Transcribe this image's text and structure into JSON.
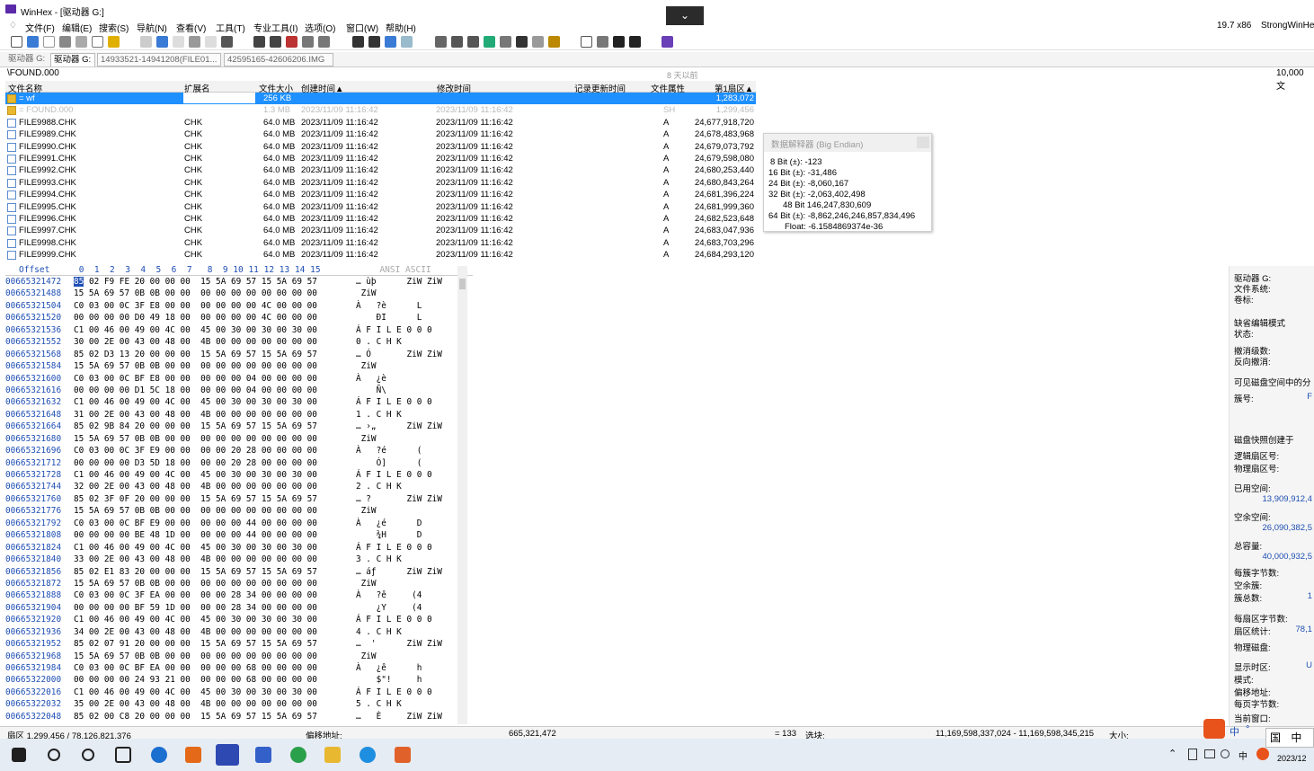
{
  "window": {
    "title": "WinHex - [驱动器 G:]",
    "version": "19.7 x86",
    "user": "StrongWinHe"
  },
  "menu": [
    "文件(F)",
    "编辑(E)",
    "搜索(S)",
    "导航(N)",
    "查看(V)",
    "工具(T)",
    "专业工具(I)",
    "选项(O)",
    "窗口(W)",
    "帮助(H)"
  ],
  "tabs": [
    "驱动器 G:",
    "驱动器 G:",
    "14933521-14941208(FILE01...",
    "42595165-42606206.IMG"
  ],
  "path": "\\FOUND.000",
  "path_middle": "8 天以前",
  "path_count": "10,000 文",
  "dir_headers": [
    "文件名称",
    "扩展名",
    "文件大小",
    "创建时间▲",
    "修改时间",
    "记录更新时间",
    "文件属性",
    "第1扇区▲"
  ],
  "dir_rows": [
    {
      "name": "= wf",
      "ext": "",
      "size": "256 KB",
      "created": "",
      "modified": "",
      "attr": "",
      "sector": "1,283,072",
      "style": "sel"
    },
    {
      "name": "= FOUND.000",
      "ext": "",
      "size": "1.3 MB",
      "created": "2023/11/09  11:16:42",
      "modified": "2023/11/09  11:16:42",
      "attr": "SH",
      "sector": "1,299,456",
      "style": "dim"
    },
    {
      "name": "FILE9988.CHK",
      "ext": "CHK",
      "size": "64.0 MB",
      "created": "2023/11/09  11:16:42",
      "modified": "2023/11/09  11:16:42",
      "attr": "A",
      "sector": "24,677,918,720",
      "style": ""
    },
    {
      "name": "FILE9989.CHK",
      "ext": "CHK",
      "size": "64.0 MB",
      "created": "2023/11/09  11:16:42",
      "modified": "2023/11/09  11:16:42",
      "attr": "A",
      "sector": "24,678,483,968",
      "style": ""
    },
    {
      "name": "FILE9990.CHK",
      "ext": "CHK",
      "size": "64.0 MB",
      "created": "2023/11/09  11:16:42",
      "modified": "2023/11/09  11:16:42",
      "attr": "A",
      "sector": "24,679,073,792",
      "style": ""
    },
    {
      "name": "FILE9991.CHK",
      "ext": "CHK",
      "size": "64.0 MB",
      "created": "2023/11/09  11:16:42",
      "modified": "2023/11/09  11:16:42",
      "attr": "A",
      "sector": "24,679,598,080",
      "style": ""
    },
    {
      "name": "FILE9992.CHK",
      "ext": "CHK",
      "size": "64.0 MB",
      "created": "2023/11/09  11:16:42",
      "modified": "2023/11/09  11:16:42",
      "attr": "A",
      "sector": "24,680,253,440",
      "style": ""
    },
    {
      "name": "FILE9993.CHK",
      "ext": "CHK",
      "size": "64.0 MB",
      "created": "2023/11/09  11:16:42",
      "modified": "2023/11/09  11:16:42",
      "attr": "A",
      "sector": "24,680,843,264",
      "style": ""
    },
    {
      "name": "FILE9994.CHK",
      "ext": "CHK",
      "size": "64.0 MB",
      "created": "2023/11/09  11:16:42",
      "modified": "2023/11/09  11:16:42",
      "attr": "A",
      "sector": "24,681,396,224",
      "style": ""
    },
    {
      "name": "FILE9995.CHK",
      "ext": "CHK",
      "size": "64.0 MB",
      "created": "2023/11/09  11:16:42",
      "modified": "2023/11/09  11:16:42",
      "attr": "A",
      "sector": "24,681,999,360",
      "style": ""
    },
    {
      "name": "FILE9996.CHK",
      "ext": "CHK",
      "size": "64.0 MB",
      "created": "2023/11/09  11:16:42",
      "modified": "2023/11/09  11:16:42",
      "attr": "A",
      "sector": "24,682,523,648",
      "style": ""
    },
    {
      "name": "FILE9997.CHK",
      "ext": "CHK",
      "size": "64.0 MB",
      "created": "2023/11/09  11:16:42",
      "modified": "2023/11/09  11:16:42",
      "attr": "A",
      "sector": "24,683,047,936",
      "style": ""
    },
    {
      "name": "FILE9998.CHK",
      "ext": "CHK",
      "size": "64.0 MB",
      "created": "2023/11/09  11:16:42",
      "modified": "2023/11/09  11:16:42",
      "attr": "A",
      "sector": "24,683,703,296",
      "style": ""
    },
    {
      "name": "FILE9999.CHK",
      "ext": "CHK",
      "size": "64.0 MB",
      "created": "2023/11/09  11:16:42",
      "modified": "2023/11/09  11:16:42",
      "attr": "A",
      "sector": "24,684,293,120",
      "style": ""
    }
  ],
  "interpreter": {
    "title": "数据解释器 (Big Endian)",
    "lines": [
      "8 Bit (±): -123",
      "16 Bit (±): -31,486",
      "24 Bit (±): -8,060,167",
      "32 Bit (±): -2,063,402,498",
      "48 Bit 146,247,830,609",
      "64 Bit (±): -8,862,246,246,857,834,496",
      "Float: -6.1584869374e-36"
    ]
  },
  "hex_header": {
    "offset": "Offset",
    "cols": " 0  1  2  3  4  5  6  7   8  9 10 11 12 13 14 15",
    "ascii": "  ANSI ASCII"
  },
  "hex_rows": [
    {
      "off": "00665321472",
      "hex": "85 02 F9 FE 20 00 00 00  15 5A 69 57 15 5A 69 57",
      "asc": "… ùþ      ZiW ZiW"
    },
    {
      "off": "00665321488",
      "hex": "15 5A 69 57 0B 0B 00 00  00 00 00 00 00 00 00 00",
      "asc": " ZiW"
    },
    {
      "off": "00665321504",
      "hex": "C0 03 00 0C 3F E8 00 00  00 00 00 00 4C 00 00 00",
      "asc": "À   ?è      L"
    },
    {
      "off": "00665321520",
      "hex": "00 00 00 00 D0 49 18 00  00 00 00 00 4C 00 00 00",
      "asc": "    ÐI      L"
    },
    {
      "off": "00665321536",
      "hex": "C1 00 46 00 49 00 4C 00  45 00 30 00 30 00 30 00",
      "asc": "Á F I L E 0 0 0"
    },
    {
      "off": "00665321552",
      "hex": "30 00 2E 00 43 00 48 00  4B 00 00 00 00 00 00 00",
      "asc": "0 . C H K"
    },
    {
      "off": "00665321568",
      "hex": "85 02 D3 13 20 00 00 00  15 5A 69 57 15 5A 69 57",
      "asc": "… Ó       ZiW ZiW"
    },
    {
      "off": "00665321584",
      "hex": "15 5A 69 57 0B 0B 00 00  00 00 00 00 00 00 00 00",
      "asc": " ZiW"
    },
    {
      "off": "00665321600",
      "hex": "C0 03 00 0C BF E8 00 00  00 00 00 04 00 00 00 00",
      "asc": "À   ¿è"
    },
    {
      "off": "00665321616",
      "hex": "00 00 00 00 D1 5C 18 00  00 00 00 04 00 00 00 00",
      "asc": "    Ñ\\"
    },
    {
      "off": "00665321632",
      "hex": "C1 00 46 00 49 00 4C 00  45 00 30 00 30 00 30 00",
      "asc": "Á F I L E 0 0 0"
    },
    {
      "off": "00665321648",
      "hex": "31 00 2E 00 43 00 48 00  4B 00 00 00 00 00 00 00",
      "asc": "1 . C H K"
    },
    {
      "off": "00665321664",
      "hex": "85 02 9B 84 20 00 00 00  15 5A 69 57 15 5A 69 57",
      "asc": "… ›„      ZiW ZiW"
    },
    {
      "off": "00665321680",
      "hex": "15 5A 69 57 0B 0B 00 00  00 00 00 00 00 00 00 00",
      "asc": " ZiW"
    },
    {
      "off": "00665321696",
      "hex": "C0 03 00 0C 3F E9 00 00  00 00 20 28 00 00 00 00",
      "asc": "À   ?é      ("
    },
    {
      "off": "00665321712",
      "hex": "00 00 00 00 D3 5D 18 00  00 00 20 28 00 00 00 00",
      "asc": "    Ó]      ("
    },
    {
      "off": "00665321728",
      "hex": "C1 00 46 00 49 00 4C 00  45 00 30 00 30 00 30 00",
      "asc": "Á F I L E 0 0 0"
    },
    {
      "off": "00665321744",
      "hex": "32 00 2E 00 43 00 48 00  4B 00 00 00 00 00 00 00",
      "asc": "2 . C H K"
    },
    {
      "off": "00665321760",
      "hex": "85 02 3F 0F 20 00 00 00  15 5A 69 57 15 5A 69 57",
      "asc": "… ?       ZiW ZiW"
    },
    {
      "off": "00665321776",
      "hex": "15 5A 69 57 0B 0B 00 00  00 00 00 00 00 00 00 00",
      "asc": " ZiW"
    },
    {
      "off": "00665321792",
      "hex": "C0 03 00 0C BF E9 00 00  00 00 00 44 00 00 00 00",
      "asc": "À   ¿é      D"
    },
    {
      "off": "00665321808",
      "hex": "00 00 00 00 BE 48 1D 00  00 00 00 44 00 00 00 00",
      "asc": "    ¾H      D"
    },
    {
      "off": "00665321824",
      "hex": "C1 00 46 00 49 00 4C 00  45 00 30 00 30 00 30 00",
      "asc": "Á F I L E 0 0 0"
    },
    {
      "off": "00665321840",
      "hex": "33 00 2E 00 43 00 48 00  4B 00 00 00 00 00 00 00",
      "asc": "3 . C H K"
    },
    {
      "off": "00665321856",
      "hex": "85 02 E1 83 20 00 00 00  15 5A 69 57 15 5A 69 57",
      "asc": "… áƒ      ZiW ZiW"
    },
    {
      "off": "00665321872",
      "hex": "15 5A 69 57 0B 0B 00 00  00 00 00 00 00 00 00 00",
      "asc": " ZiW"
    },
    {
      "off": "00665321888",
      "hex": "C0 03 00 0C 3F EA 00 00  00 00 28 34 00 00 00 00",
      "asc": "À   ?ê     (4"
    },
    {
      "off": "00665321904",
      "hex": "00 00 00 00 BF 59 1D 00  00 00 28 34 00 00 00 00",
      "asc": "    ¿Y     (4"
    },
    {
      "off": "00665321920",
      "hex": "C1 00 46 00 49 00 4C 00  45 00 30 00 30 00 30 00",
      "asc": "Á F I L E 0 0 0"
    },
    {
      "off": "00665321936",
      "hex": "34 00 2E 00 43 00 48 00  4B 00 00 00 00 00 00 00",
      "asc": "4 . C H K"
    },
    {
      "off": "00665321952",
      "hex": "85 02 07 91 20 00 00 00  15 5A 69 57 15 5A 69 57",
      "asc": "…  '      ZiW ZiW"
    },
    {
      "off": "00665321968",
      "hex": "15 5A 69 57 0B 0B 00 00  00 00 00 00 00 00 00 00",
      "asc": " ZiW"
    },
    {
      "off": "00665321984",
      "hex": "C0 03 00 0C BF EA 00 00  00 00 00 68 00 00 00 00",
      "asc": "À   ¿ê      h"
    },
    {
      "off": "00665322000",
      "hex": "00 00 00 00 24 93 21 00  00 00 00 68 00 00 00 00",
      "asc": "    $\"!     h"
    },
    {
      "off": "00665322016",
      "hex": "C1 00 46 00 49 00 4C 00  45 00 30 00 30 00 30 00",
      "asc": "Á F I L E 0 0 0"
    },
    {
      "off": "00665322032",
      "hex": "35 00 2E 00 43 00 48 00  4B 00 00 00 00 00 00 00",
      "asc": "5 . C H K"
    },
    {
      "off": "00665322048",
      "hex": "85 02 00 C8 20 00 00 00  15 5A 69 57 15 5A 69 57",
      "asc": "…   È     ZiW ZiW"
    }
  ],
  "info_panel": [
    {
      "label": "驱动器 G:",
      "value": ""
    },
    {
      "label": "文件系统:",
      "value": ""
    },
    {
      "label": "卷标:",
      "value": ""
    },
    {
      "label": "缺省编辑模式",
      "value": ""
    },
    {
      "label": "状态:",
      "value": ""
    },
    {
      "label": "撤消级数:",
      "value": ""
    },
    {
      "label": "反向撤消:",
      "value": ""
    },
    {
      "label": "可见磁盘空间中的分",
      "value": ""
    },
    {
      "label": "簇号:",
      "value": "F"
    },
    {
      "label": "磁盘快照创建于",
      "value": ""
    },
    {
      "label": "逻辑扇区号:",
      "value": ""
    },
    {
      "label": "物理扇区号:",
      "value": ""
    },
    {
      "label": "已用空间:",
      "value": "13,909,912,4"
    },
    {
      "label": "空余空间:",
      "value": "26,090,382,5"
    },
    {
      "label": "总容量:",
      "value": "40,000,932,5"
    },
    {
      "label": "每簇字节数:",
      "value": ""
    },
    {
      "label": "空余簇:",
      "value": ""
    },
    {
      "label": "簇总数:",
      "value": "1"
    },
    {
      "label": "每扇区字节数:",
      "value": ""
    },
    {
      "label": "扇区统计:",
      "value": "78,1"
    },
    {
      "label": "物理磁盘:",
      "value": ""
    },
    {
      "label": "显示时区:",
      "value": "U"
    },
    {
      "label": "模式:",
      "value": ""
    },
    {
      "label": "偏移地址:",
      "value": ""
    },
    {
      "label": "每页字节数:",
      "value": ""
    },
    {
      "label": "当前窗口:",
      "value": ""
    }
  ],
  "status": {
    "sector": "扇区 1,299,456 / 78,126,821,376",
    "offset_label": "偏移地址:",
    "offset_value": "665,321,472",
    "value": "= 133",
    "sel_label": "选块:",
    "range": "11,169,598,337,024 - 11,169,598,345,215",
    "size_label": "大小:"
  },
  "taskbar": {
    "time": "2023/12",
    "ime": "中",
    "ime2": "中",
    "ime3": "国"
  }
}
